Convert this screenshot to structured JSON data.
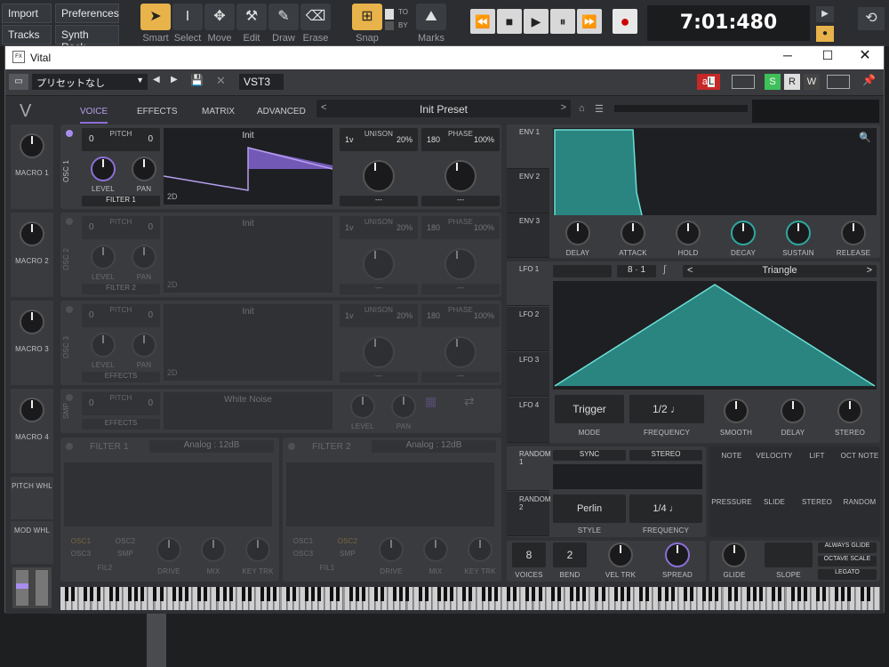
{
  "host": {
    "menu": {
      "import": "Import",
      "preferences": "Preferences",
      "tracks": "Tracks",
      "synth_rack": "Synth Rack"
    },
    "tools": [
      "Smart",
      "Select",
      "Move",
      "Edit",
      "Draw",
      "Erase"
    ],
    "snap": "Snap",
    "snap_to": "TO",
    "snap_by": "BY",
    "marks": "Marks",
    "time": "7:01:480"
  },
  "window": {
    "title": "Vital",
    "fx_icon": "FX"
  },
  "plugbar": {
    "preset": "プリセットなし",
    "format": "VST3",
    "a_label": "a",
    "l_label": "L",
    "s_label": "S",
    "r_label": "R",
    "w_label": "W"
  },
  "vital": {
    "tabs": [
      "VOICE",
      "EFFECTS",
      "MATRIX",
      "ADVANCED"
    ],
    "preset_name": "Init Preset",
    "macros": [
      "MACRO 1",
      "MACRO 2",
      "MACRO 3",
      "MACRO 4"
    ],
    "pitch_whl": "PITCH WHL",
    "mod_whl": "MOD WHL",
    "osc": [
      {
        "name": "OSC 1",
        "pitch_label": "PITCH",
        "pitch_a": "0",
        "pitch_b": "0",
        "wave": "Init",
        "dim": "2D",
        "unison_label": "UNISON",
        "unison_voices": "1v",
        "unison_pct": "20%",
        "phase_label": "PHASE",
        "phase_val": "180",
        "phase_pct": "100%",
        "level": "LEVEL",
        "pan": "PAN",
        "dest": "FILTER 1",
        "unison_dest": "---",
        "phase_dest": "---"
      },
      {
        "name": "OSC 2",
        "pitch_label": "PITCH",
        "pitch_a": "0",
        "pitch_b": "0",
        "wave": "Init",
        "dim": "2D",
        "unison_label": "UNISON",
        "unison_voices": "1v",
        "unison_pct": "20%",
        "phase_label": "PHASE",
        "phase_val": "180",
        "phase_pct": "100%",
        "level": "LEVEL",
        "pan": "PAN",
        "dest": "FILTER 2",
        "unison_dest": "---",
        "phase_dest": "---"
      },
      {
        "name": "OSC 3",
        "pitch_label": "PITCH",
        "pitch_a": "0",
        "pitch_b": "0",
        "wave": "Init",
        "dim": "2D",
        "unison_label": "UNISON",
        "unison_voices": "1v",
        "unison_pct": "20%",
        "phase_label": "PHASE",
        "phase_val": "180",
        "phase_pct": "100%",
        "level": "LEVEL",
        "pan": "PAN",
        "dest": "EFFECTS",
        "unison_dest": "---",
        "phase_dest": "---"
      }
    ],
    "sample": {
      "name": "SMP",
      "pitch_label": "PITCH",
      "pitch_a": "0",
      "pitch_b": "0",
      "wave": "White Noise",
      "level": "LEVEL",
      "pan": "PAN",
      "dest": "EFFECTS"
    },
    "filters": [
      {
        "name": "FILTER 1",
        "type": "Analog : 12dB",
        "src": [
          "OSC1",
          "OSC2",
          "OSC3",
          "SMP"
        ],
        "fil": "FIL2",
        "drive": "DRIVE",
        "mix": "MIX",
        "key_trk": "KEY TRK"
      },
      {
        "name": "FILTER 2",
        "type": "Analog : 12dB",
        "src": [
          "OSC1",
          "OSC2",
          "OSC3",
          "SMP"
        ],
        "fil": "FIL1",
        "drive": "DRIVE",
        "mix": "MIX",
        "key_trk": "KEY TRK"
      }
    ],
    "env_tabs": [
      "ENV 1",
      "ENV 2",
      "ENV 3"
    ],
    "env_knobs": [
      "DELAY",
      "ATTACK",
      "HOLD",
      "DECAY",
      "SUSTAIN",
      "RELEASE"
    ],
    "lfo_tabs": [
      "LFO 1",
      "LFO 2",
      "LFO 3",
      "LFO 4"
    ],
    "lfo": {
      "sync_a": "8",
      "sync_b": "1",
      "shape": "Triangle",
      "mode_val": "Trigger",
      "mode": "MODE",
      "freq_val": "1/2",
      "frequency": "FREQUENCY",
      "smooth": "SMOOTH",
      "delay": "DELAY",
      "stereo": "STEREO"
    },
    "random_tabs": [
      "RANDOM 1",
      "RANDOM 2"
    ],
    "random": {
      "sync": "SYNC",
      "stereo": "STEREO",
      "style_val": "Perlin",
      "style": "STYLE",
      "freq_val": "1/4",
      "frequency": "FREQUENCY"
    },
    "mod_sources": [
      "NOTE",
      "VELOCITY",
      "LIFT",
      "OCT NOTE",
      "PRESSURE",
      "SLIDE",
      "STEREO",
      "RANDOM"
    ],
    "voice": {
      "voices_val": "8",
      "voices": "VOICES",
      "bend_val": "2",
      "bend": "BEND",
      "vel_trk": "VEL TRK",
      "spread": "SPREAD",
      "glide": "GLIDE",
      "slope": "SLOPE",
      "always_glide": "ALWAYS GLIDE",
      "octave_scale": "OCTAVE SCALE",
      "legato": "LEGATO"
    }
  },
  "colors": {
    "accent": "#8c6fd6",
    "teal": "#2fa7a0",
    "bg": "#303134"
  }
}
